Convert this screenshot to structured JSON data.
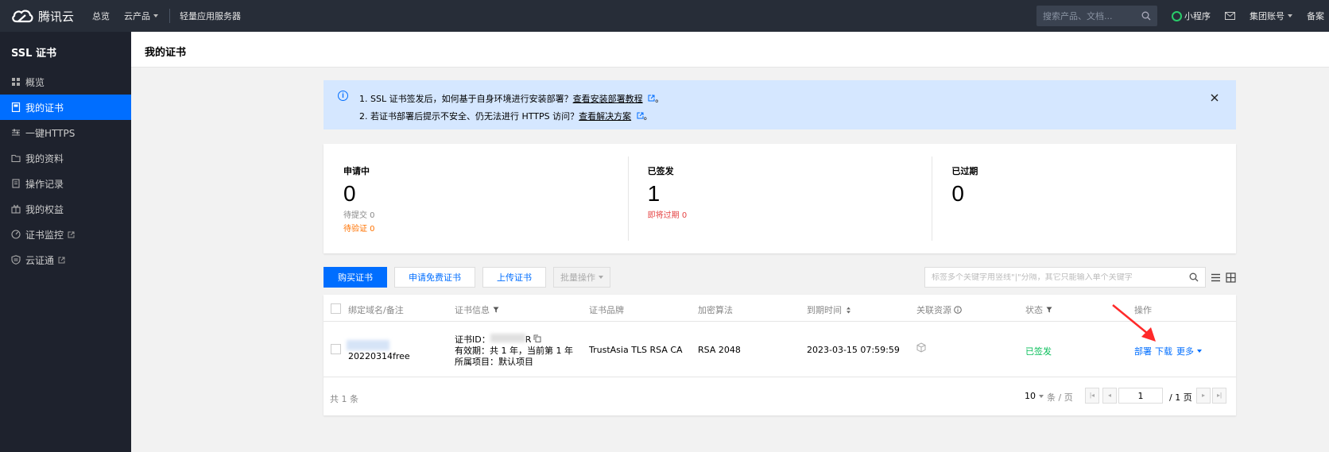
{
  "topbar": {
    "brand": "腾讯云",
    "nav": [
      "总览",
      "云产品",
      "轻量应用服务器"
    ],
    "search_placeholder": "搜索产品、文档...",
    "miniprogram": "小程序",
    "account": "集团账号",
    "beian": "备案"
  },
  "sidebar": {
    "title": "SSL 证书",
    "items": [
      {
        "label": "概览",
        "icon": "grid-icon"
      },
      {
        "label": "我的证书",
        "icon": "certificate-icon",
        "active": true
      },
      {
        "label": "一键HTTPS",
        "icon": "sliders-icon"
      },
      {
        "label": "我的资料",
        "icon": "folder-icon"
      },
      {
        "label": "操作记录",
        "icon": "document-icon"
      },
      {
        "label": "我的权益",
        "icon": "gift-icon"
      },
      {
        "label": "证书监控",
        "icon": "gauge-icon",
        "external": true
      },
      {
        "label": "云证通",
        "icon": "shield-icon",
        "external": true
      }
    ]
  },
  "page": {
    "title": "我的证书"
  },
  "alert": {
    "line1_text": "1. SSL 证书签发后，如何基于自身环境进行安装部署？",
    "line1_link": "查看安装部署教程",
    "line2_text": "2. 若证书部署后提示不安全、仍无法进行 HTTPS 访问？",
    "line2_link": "查看解决方案"
  },
  "stats": [
    {
      "title": "申请中",
      "value": "0",
      "subs": [
        {
          "text": "待提交 0",
          "color": "gray"
        },
        {
          "text": "待验证 0",
          "color": "orange"
        }
      ]
    },
    {
      "title": "已签发",
      "value": "1",
      "subs": [
        {
          "text": "即将过期 0",
          "color": "red"
        }
      ]
    },
    {
      "title": "已过期",
      "value": "0",
      "subs": []
    }
  ],
  "toolbar": {
    "buy": "购买证书",
    "free": "申请免费证书",
    "upload": "上传证书",
    "batch": "批量操作",
    "search_placeholder": "标签多个关键字用竖线\"|\"分隔，其它只能输入单个关键字"
  },
  "table": {
    "columns": [
      "绑定域名/备注",
      "证书信息",
      "证书品牌",
      "加密算法",
      "到期时间",
      "关联资源",
      "状态",
      "操作"
    ],
    "rows": [
      {
        "domain_note": "20220314free",
        "cert_id_label": "证书ID：",
        "cert_id_suffix": "R",
        "validity": "有效期：共 1 年，当前第 1 年",
        "project": "所属项目：默认项目",
        "brand": "TrustAsia TLS RSA CA",
        "algorithm": "RSA 2048",
        "expiry": "2023-03-15 07:59:59",
        "status": "已签发",
        "actions": [
          "部署",
          "下载",
          "更多"
        ]
      }
    ],
    "total": "共 1 条",
    "page_size": "10",
    "per_page": "条 / 页",
    "current_page": "1",
    "total_pages": "/ 1 页"
  }
}
